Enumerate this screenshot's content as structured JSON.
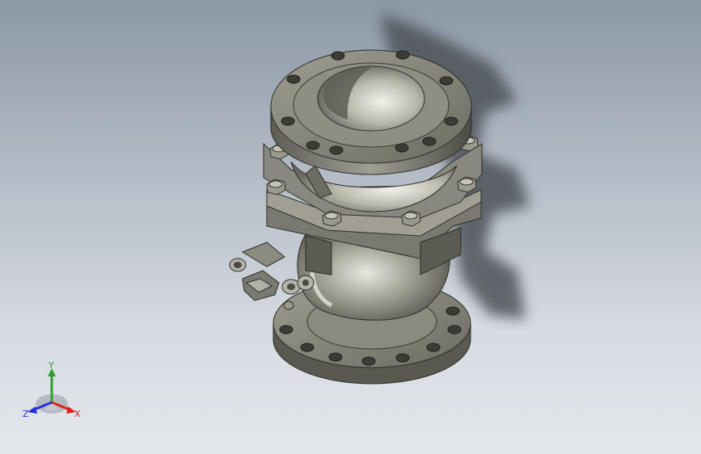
{
  "viewport": {
    "background_top": "#8d98a6",
    "background_bottom": "#e4e7ec"
  },
  "model": {
    "metal_color": "#6e6d63",
    "metal_light": "#c9c8bd",
    "shadow_color": "#4e5259"
  },
  "triad": {
    "x_label": "X",
    "y_label": "Y",
    "z_label": "Z",
    "x_color": "#e0201b",
    "y_color": "#2aa02a",
    "z_color": "#2330d8"
  }
}
